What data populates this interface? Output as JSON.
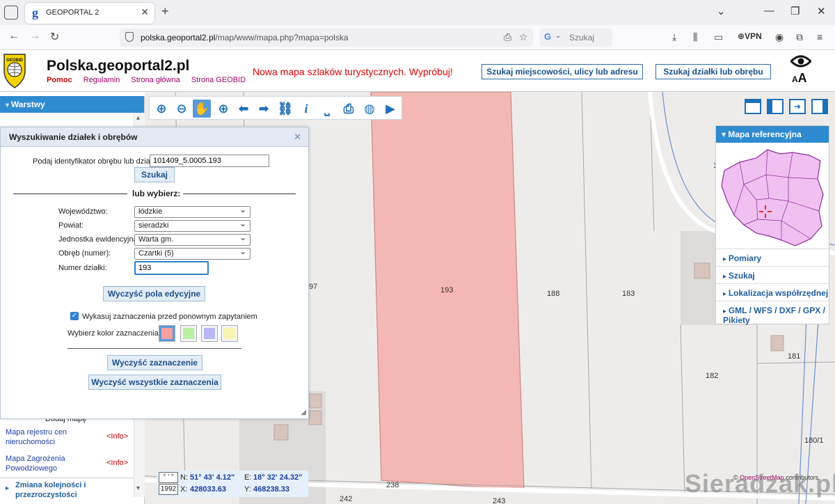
{
  "browser": {
    "tab_title": "GEOPORTAL 2",
    "favicon": "g",
    "url_domain": "polska.geoportal2.pl",
    "url_path": "/map/www/mapa.php?mapa=polska",
    "search_placeholder": "Szukaj",
    "search_engine_badge": "G",
    "vpn_label": "VPN"
  },
  "site": {
    "logo_text": "GEOBID",
    "title": "Polska.geoportal2.pl",
    "links": [
      "Pomoc",
      "Regulamin",
      "Strona główna",
      "Strona GEOBID"
    ],
    "promo": "Nowa mapa szlaków turystycznych. Wypróbuj!",
    "search_address_button": "Szukaj miejscowości, ulicy lub adresu",
    "search_parcel_button": "Szukaj działki lub obrębu",
    "font_size_small": "A",
    "font_size_large": "A"
  },
  "sidebar": {
    "header": "Warstwy",
    "partial_text": "Dodaj mapę",
    "items": [
      {
        "label": "Mapa rejestru cen nieruchomości",
        "info": "<Info>"
      },
      {
        "label": "Mapa Zagrożenia Powodziowego",
        "info": "<Info>"
      }
    ],
    "bottom_label": "Zmiana kolejności i przezroczystości"
  },
  "dialog": {
    "title": "Wyszukiwanie działek i obrębów",
    "id_label": "Podaj identyfikator obrębu lub działki:",
    "id_value": "101409_5.0005.193",
    "search_button": "Szukaj",
    "or_choose": "lub wybierz:",
    "fields": [
      {
        "label": "Województwo:",
        "value": "łódzkie"
      },
      {
        "label": "Powiat:",
        "value": "sieradzki"
      },
      {
        "label": "Jednostka ewidencyjna:",
        "value": "Warta gm."
      },
      {
        "label": "Obręb (numer):",
        "value": "Czartki (5)"
      }
    ],
    "parcel_label": "Numer działki:",
    "parcel_value": "193",
    "clear_fields_button": "Wyczyść pola edycyjne",
    "checkbox_label": "Wykasuj zaznaczenia przed ponownym zapytaniem",
    "checkbox_checked": true,
    "color_label": "Wybierz kolor zaznaczenia:",
    "colors": [
      "#f4a0a0",
      "#b8f0a0",
      "#b8b8f8",
      "#f8f4b0"
    ],
    "clear_selection_button": "Wyczyść zaznaczenie",
    "clear_all_button": "Wyczyść wszystkie zaznaczenia"
  },
  "map": {
    "highlight_color": "#f4b8b4",
    "plot_labels": [
      "193",
      "188",
      "183",
      "182",
      "181",
      "180/1",
      "238",
      "242",
      "243",
      "1",
      "97"
    ]
  },
  "coords": {
    "dms_button": "° ' \"",
    "n_label": "N:",
    "n_value": "51° 43' 4.12\"",
    "e_label": "E:",
    "e_value": "18° 32' 24.32\"",
    "system_button": "1992",
    "x_label": "X:",
    "x_value": "428033.63",
    "y_label": "Y:",
    "y_value": "468238.33"
  },
  "ref_panel": {
    "header": "Mapa referencyjna",
    "items": [
      "Pomiary",
      "Szukaj",
      "Lokalizacja współrzędnej",
      "GML / WFS / DXF / GPX / Pikiety"
    ]
  },
  "attribution": {
    "prefix": "© ",
    "link": "OpenStreetMap",
    "suffix": " contributors"
  },
  "watermark": "Sieradzak.pl"
}
